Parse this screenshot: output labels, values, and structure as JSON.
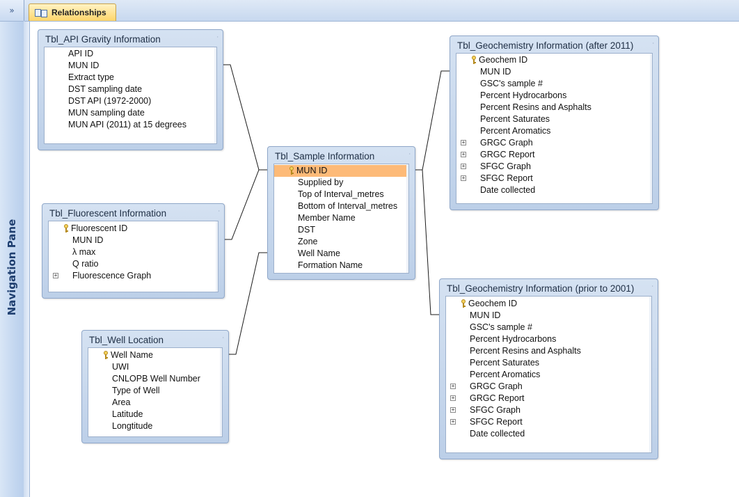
{
  "navigation_pane": {
    "title": "Navigation Pane",
    "toggle": "»"
  },
  "tab": {
    "label": "Relationships",
    "icon": "relationships-icon"
  },
  "tables": [
    {
      "id": "api",
      "title": "Tbl_API Gravity Information",
      "fields": [
        {
          "name": "API ID",
          "key": false,
          "expand": false
        },
        {
          "name": "MUN ID",
          "key": false,
          "expand": false
        },
        {
          "name": "Extract type",
          "key": false,
          "expand": false
        },
        {
          "name": "DST sampling date",
          "key": false,
          "expand": false
        },
        {
          "name": "DST API (1972-2000)",
          "key": false,
          "expand": false
        },
        {
          "name": "MUN sampling date",
          "key": false,
          "expand": false
        },
        {
          "name": "MUN API (2011) at 15 degrees",
          "key": false,
          "expand": false
        }
      ]
    },
    {
      "id": "fluor",
      "title": "Tbl_Fluorescent Information",
      "fields": [
        {
          "name": "Fluorescent ID",
          "key": true,
          "expand": false
        },
        {
          "name": "MUN ID",
          "key": false,
          "expand": false
        },
        {
          "name": "λ max",
          "key": false,
          "expand": false
        },
        {
          "name": "Q ratio",
          "key": false,
          "expand": false
        },
        {
          "name": "Fluorescence Graph",
          "key": false,
          "expand": true
        }
      ]
    },
    {
      "id": "well",
      "title": "Tbl_Well Location",
      "fields": [
        {
          "name": "Well Name",
          "key": true,
          "expand": false
        },
        {
          "name": "UWI",
          "key": false,
          "expand": false
        },
        {
          "name": "CNLOPB Well Number",
          "key": false,
          "expand": false
        },
        {
          "name": "Type of Well",
          "key": false,
          "expand": false
        },
        {
          "name": "Area",
          "key": false,
          "expand": false
        },
        {
          "name": "Latitude",
          "key": false,
          "expand": false
        },
        {
          "name": "Longtitude",
          "key": false,
          "expand": false
        }
      ]
    },
    {
      "id": "sample",
      "title": "Tbl_Sample Information",
      "fields": [
        {
          "name": "MUN ID",
          "key": true,
          "expand": false,
          "selected": true
        },
        {
          "name": "Supplied by",
          "key": false,
          "expand": false
        },
        {
          "name": "Top of Interval_metres",
          "key": false,
          "expand": false
        },
        {
          "name": "Bottom of Interval_metres",
          "key": false,
          "expand": false
        },
        {
          "name": "Member Name",
          "key": false,
          "expand": false
        },
        {
          "name": "DST",
          "key": false,
          "expand": false
        },
        {
          "name": "Zone",
          "key": false,
          "expand": false
        },
        {
          "name": "Well Name",
          "key": false,
          "expand": false
        },
        {
          "name": "Formation Name",
          "key": false,
          "expand": false
        }
      ]
    },
    {
      "id": "geo2011",
      "title": "Tbl_Geochemistry Information (after 2011)",
      "fields": [
        {
          "name": "Geochem ID",
          "key": true,
          "expand": false
        },
        {
          "name": "MUN ID",
          "key": false,
          "expand": false
        },
        {
          "name": "GSC's sample #",
          "key": false,
          "expand": false
        },
        {
          "name": "Percent Hydrocarbons",
          "key": false,
          "expand": false
        },
        {
          "name": "Percent Resins and Asphalts",
          "key": false,
          "expand": false
        },
        {
          "name": "Percent Saturates",
          "key": false,
          "expand": false
        },
        {
          "name": "Percent Aromatics",
          "key": false,
          "expand": false
        },
        {
          "name": "GRGC Graph",
          "key": false,
          "expand": true
        },
        {
          "name": "GRGC Report",
          "key": false,
          "expand": true
        },
        {
          "name": "SFGC Graph",
          "key": false,
          "expand": true
        },
        {
          "name": "SFGC Report",
          "key": false,
          "expand": true
        },
        {
          "name": "Date collected",
          "key": false,
          "expand": false
        }
      ]
    },
    {
      "id": "geo2001",
      "title": "Tbl_Geochemistry Information (prior to 2001)",
      "fields": [
        {
          "name": "Geochem ID",
          "key": true,
          "expand": false
        },
        {
          "name": "MUN ID",
          "key": false,
          "expand": false
        },
        {
          "name": "GSC's sample #",
          "key": false,
          "expand": false
        },
        {
          "name": "Percent Hydrocarbons",
          "key": false,
          "expand": false
        },
        {
          "name": "Percent Resins and Asphalts",
          "key": false,
          "expand": false
        },
        {
          "name": "Percent Saturates",
          "key": false,
          "expand": false
        },
        {
          "name": "Percent Aromatics",
          "key": false,
          "expand": false
        },
        {
          "name": "GRGC Graph",
          "key": false,
          "expand": true
        },
        {
          "name": "GRGC Report",
          "key": false,
          "expand": true
        },
        {
          "name": "SFGC Graph",
          "key": false,
          "expand": true
        },
        {
          "name": "SFGC Report",
          "key": false,
          "expand": true
        },
        {
          "name": "Date collected",
          "key": false,
          "expand": false
        }
      ]
    }
  ],
  "relationships": [
    {
      "from": "api",
      "from_field": "MUN ID",
      "to": "sample",
      "to_field": "MUN ID"
    },
    {
      "from": "fluor",
      "from_field": "MUN ID",
      "to": "sample",
      "to_field": "MUN ID"
    },
    {
      "from": "well",
      "from_field": "Well Name",
      "to": "sample",
      "to_field": "Well Name"
    },
    {
      "from": "sample",
      "from_field": "MUN ID",
      "to": "geo2011",
      "to_field": "MUN ID"
    },
    {
      "from": "sample",
      "from_field": "MUN ID",
      "to": "geo2001",
      "to_field": "MUN ID"
    }
  ],
  "colors": {
    "selected_row": "#fdba78",
    "table_header": "#c9d9ee",
    "nav_title": "#1f3f70"
  }
}
